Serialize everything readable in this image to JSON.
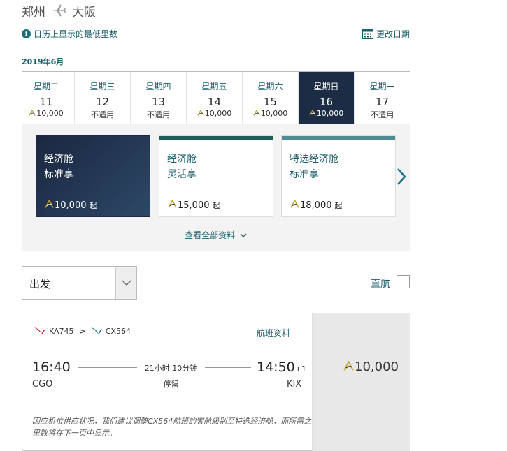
{
  "route": {
    "origin": "郑州",
    "destination": "大阪"
  },
  "info": {
    "lowest_miles_note": "日历上显示的最低里数",
    "change_date": "更改日期"
  },
  "calendar": {
    "month": "2019年6月",
    "days": [
      {
        "weekday": "星期二",
        "date": "11",
        "value": "10,000",
        "has_miles": true
      },
      {
        "weekday": "星期三",
        "date": "12",
        "value": "不适用",
        "has_miles": false
      },
      {
        "weekday": "星期四",
        "date": "13",
        "value": "不适用",
        "has_miles": false
      },
      {
        "weekday": "星期五",
        "date": "14",
        "value": "10,000",
        "has_miles": true
      },
      {
        "weekday": "星期六",
        "date": "15",
        "value": "10,000",
        "has_miles": true
      },
      {
        "weekday": "星期日",
        "date": "16",
        "value": "10,000",
        "has_miles": true,
        "selected": true
      },
      {
        "weekday": "星期一",
        "date": "17",
        "value": "不适用",
        "has_miles": false
      }
    ]
  },
  "fares": [
    {
      "cabin": "经济舱",
      "type": "标准享",
      "price": "10,000",
      "from": "起",
      "active": true
    },
    {
      "cabin": "经济舱",
      "type": "灵活享",
      "price": "15,000",
      "from": "起",
      "bar_color": "#1f5c5a"
    },
    {
      "cabin": "特选经济舱",
      "type": "标准享",
      "price": "18,000",
      "from": "起",
      "bar_color": "#4f8a94"
    }
  ],
  "view_all": "查看全部资料",
  "filter": {
    "direction": "出发",
    "nonstop_label": "直航"
  },
  "flight": {
    "flight1": "KA745",
    "flight2": "CX564",
    "info_link": "航班资料",
    "dep_time": "16:40",
    "dep_code": "CGO",
    "arr_time": "14:50",
    "arr_day_offset": "+1",
    "arr_code": "KIX",
    "duration": "21小时 10分钟",
    "stops": "停留",
    "price": "10,000",
    "notice": "因应机位供应状况，我们建议调整CX564航班的客舱级别至特选经济舱，而所需之里数将在下一页中显示。"
  },
  "colors": {
    "accent": "#1a5e6a",
    "selected": "#1c2c44",
    "panel": "#f3f3f3"
  },
  "icons": [
    "plane-icon",
    "info-icon",
    "calendar-icon",
    "asia-miles-icon",
    "chevron-right-icon",
    "chevron-down-icon",
    "airline-logo-icon"
  ]
}
